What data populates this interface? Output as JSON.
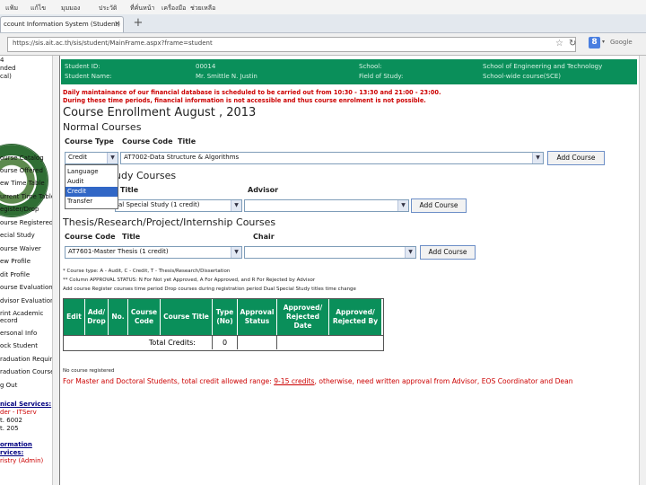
{
  "browser": {
    "menu": [
      "แฟ้ม",
      "แก้ไข",
      "มุมมอง",
      "ประวัติ",
      "ที่คั่นหน้า",
      "เครื่องมือ",
      "ช่วยเหลือ"
    ],
    "tab_title": "ccount Information System (Student)",
    "url": "https://sis.ait.ac.th/sis/student/MainFrame.aspx?frame=student",
    "search_hint": "Google"
  },
  "left_nav": {
    "top_fragments": [
      "4",
      "nded",
      "cal)"
    ],
    "items": [
      "ourse Catalog",
      "ourse Offered",
      "ew Time Table",
      "urrent Time Table",
      "egister/Drop",
      "ourse Registered",
      "ecial Study",
      "ourse Waiver",
      "ew Profile",
      "dit Profile",
      "ourse Evaluation",
      "dvisor Evaluation",
      "rint Academic",
      "ecord",
      "ersonal Info",
      "ock Student",
      "raduation Requirement",
      "raduation Courses",
      "g Out"
    ],
    "services_title": "nical Services:",
    "services_lines": [
      "der - ITServ",
      "t. 6002",
      "t. 205"
    ],
    "info_title": "ormation",
    "info_title2": "rvices:",
    "info_line": "ristry (Admin)"
  },
  "student": {
    "id_label": "Student ID:",
    "id_value": "00014",
    "name_label": "Student Name:",
    "name_value": "Mr. Smittle N. Justin",
    "school_label": "School:",
    "school_value": "School of Engineering and Technology",
    "field_label": "Field of Study:",
    "field_value": "School-wide course(SCE)"
  },
  "notice": {
    "line1": "Daily maintainance of our financial database is scheduled to be carried out from 10:30 - 13:30 and 21:00 - 23:00.",
    "line2": "During these time periods, financial information is not accessible and thus course enrolment is not possible."
  },
  "enroll": {
    "heading": "Course Enrollment  August , 2013",
    "normal_heading": "Normal Courses",
    "col_type": "Course Type",
    "col_code": "Course Code",
    "col_title": "Title",
    "type_value": "Credit",
    "course_value": "AT7002-Data Structure & Algorithms",
    "add_label": "Add Course",
    "type_options": [
      "Language",
      "Audit",
      "Credit",
      "Transfer"
    ],
    "special_heading_fragment": "udy Courses",
    "special_title": "Title",
    "special_advisor": "Advisor",
    "special_value": "al Special Study (1 credit)",
    "thesis_heading": "Thesis/Research/Project/Internship Courses",
    "thesis_code": "Course Code",
    "thesis_title": "Title",
    "thesis_chair": "Chair",
    "thesis_value": "AT7601-Master Thesis (1 credit)",
    "legend1": "* Course type: A - Audit, C - Credit, T - Thesis/Research/Dissertation",
    "legend2": "** Column APPROVAL STATUS: N For Not yet Approved, A For Approved, and R For Rejected by Advisor",
    "legend3": "Add course   Register courses   time period   Drop courses during registration period   Dual Special Study   titles   time          change"
  },
  "table": {
    "headers": [
      "Edit",
      "Add/ Drop",
      "No.",
      "Course Code",
      "Course Title",
      "Type (No)",
      "Approval Status",
      "Approved/ Rejected Date",
      "Approved/ Rejected By"
    ],
    "total_label": "Total Credits:",
    "total_value": "0"
  },
  "footer": {
    "none_registered": "No course registered",
    "warning_before": "For Master and Doctoral Students, total credit allowed range: ",
    "warning_range": "9-15 credits",
    "warning_after": ", otherwise, need written approval from Advisor, EOS Coordinator and Dean"
  },
  "colors": {
    "header_green": "#0a8f5a",
    "alert_red": "#cc0000"
  }
}
